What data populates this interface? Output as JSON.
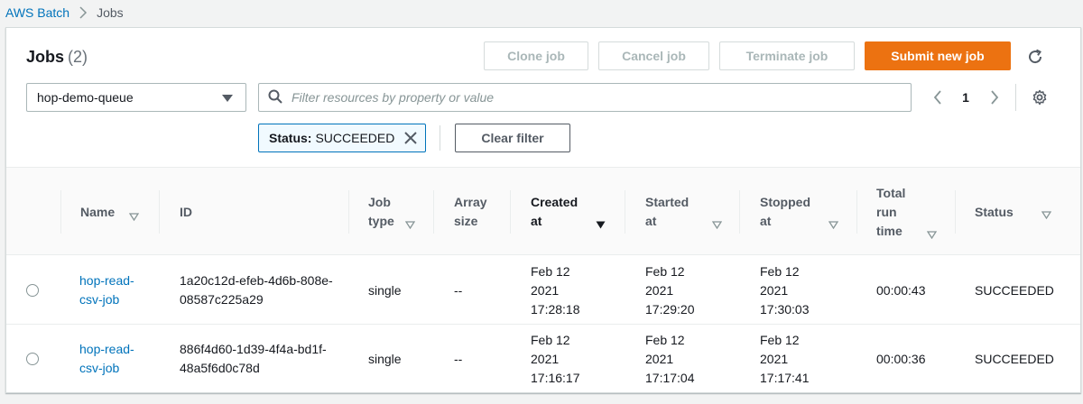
{
  "breadcrumb": {
    "root": "AWS Batch",
    "current": "Jobs"
  },
  "header": {
    "title": "Jobs",
    "count": "(2)"
  },
  "actions": {
    "clone": "Clone job",
    "cancel": "Cancel job",
    "terminate": "Terminate job",
    "submit": "Submit new job"
  },
  "queue_select": {
    "value": "hop-demo-queue"
  },
  "search": {
    "placeholder": "Filter resources by property or value"
  },
  "pagination": {
    "page": "1"
  },
  "filter_token": {
    "key": "Status:",
    "value": "SUCCEEDED"
  },
  "clear_filter": "Clear filter",
  "columns": {
    "name": "Name",
    "id": "ID",
    "job_type": "Job type",
    "array_size": "Array size",
    "created_at": "Created at",
    "started_at": "Started at",
    "stopped_at": "Stopped at",
    "total_run_time": "Total run time",
    "status": "Status"
  },
  "rows": [
    {
      "name": "hop-read-csv-job",
      "id": "1a20c12d-efeb-4d6b-808e-08587c225a29",
      "job_type": "single",
      "array_size": "--",
      "created_at": "Feb 12 2021 17:28:18",
      "started_at": "Feb 12 2021 17:29:20",
      "stopped_at": "Feb 12 2021 17:30:03",
      "total_run_time": "00:00:43",
      "status": "SUCCEEDED"
    },
    {
      "name": "hop-read-csv-job",
      "id": "886f4d60-1d39-4f4a-bd1f-48a5f6d0c78d",
      "job_type": "single",
      "array_size": "--",
      "created_at": "Feb 12 2021 17:16:17",
      "started_at": "Feb 12 2021 17:17:04",
      "stopped_at": "Feb 12 2021 17:17:41",
      "total_run_time": "00:00:36",
      "status": "SUCCEEDED"
    }
  ],
  "colors": {
    "primary": "#ec7211",
    "link": "#0073bb",
    "token_border": "#0073bb"
  }
}
